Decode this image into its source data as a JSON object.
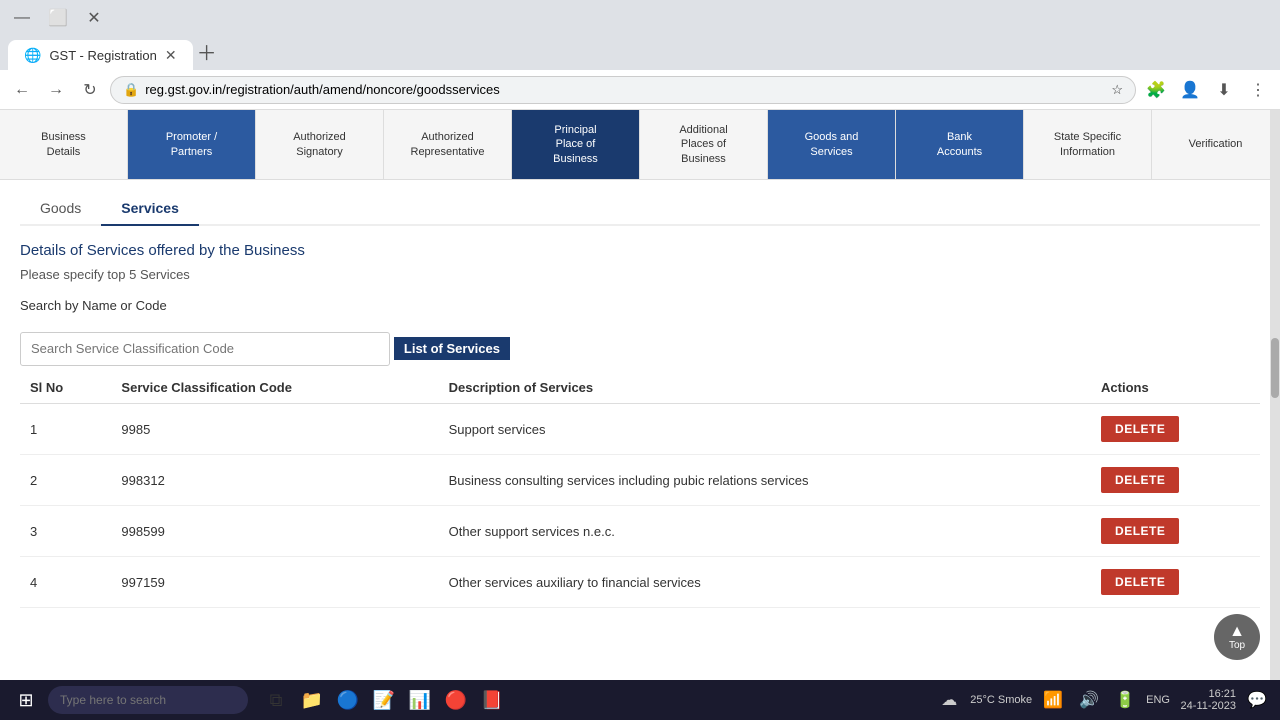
{
  "browser": {
    "tab_title": "GST - Registration",
    "url": "reg.gst.gov.in/registration/auth/amend/noncore/goodsservices",
    "tab_favicon": "🌐"
  },
  "nav_tabs": [
    {
      "id": "business-details",
      "label": "Business\nDetails",
      "active": false
    },
    {
      "id": "promoter-partners",
      "label": "Promoter /\nPartners",
      "active": false,
      "highlighted": true
    },
    {
      "id": "authorized-signatory",
      "label": "Authorized\nSignatory",
      "active": false
    },
    {
      "id": "authorized-representative",
      "label": "Authorized\nRepresentative",
      "active": false
    },
    {
      "id": "principal-place",
      "label": "Principal\nPlace of\nBusiness",
      "active": true
    },
    {
      "id": "additional-places",
      "label": "Additional\nPlaces of\nBusiness",
      "active": false
    },
    {
      "id": "goods-services",
      "label": "Goods and\nServices",
      "active": false,
      "highlighted": true
    },
    {
      "id": "bank-accounts",
      "label": "Bank\nAccounts",
      "active": false,
      "highlighted": true
    },
    {
      "id": "state-specific",
      "label": "State Specific\nInformation",
      "active": false
    },
    {
      "id": "verification",
      "label": "Verification",
      "active": false
    }
  ],
  "section_tabs": [
    {
      "id": "goods",
      "label": "Goods",
      "active": false
    },
    {
      "id": "services",
      "label": "Services",
      "active": true
    }
  ],
  "heading": "Details of Services offered by the Business",
  "subtitle": "Please specify top 5 Services",
  "search_label": "Search by Name or Code",
  "search_placeholder": "Search Service Classification Code",
  "list_heading": "List of Services",
  "table": {
    "columns": [
      "Sl No",
      "Service Classification Code",
      "Description of Services",
      "Actions"
    ],
    "rows": [
      {
        "sl": "1",
        "code": "9985",
        "description": "Support services",
        "action": "DELETE"
      },
      {
        "sl": "2",
        "code": "998312",
        "description": "Business consulting services including pubic relations services",
        "action": "DELETE"
      },
      {
        "sl": "3",
        "code": "998599",
        "description": "Other support services n.e.c.",
        "action": "DELETE"
      },
      {
        "sl": "4",
        "code": "997159",
        "description": "Other services auxiliary to financial services",
        "action": "DELETE"
      }
    ]
  },
  "top_button": {
    "arrow": "▲",
    "label": "Top"
  },
  "taskbar": {
    "search_placeholder": "Type here to search",
    "time": "16:21",
    "date": "24-11-2023",
    "weather": "25°C  Smoke",
    "lang": "ENG"
  },
  "colors": {
    "nav_active": "#1a3a6e",
    "nav_highlighted": "#2c5aa0",
    "delete_btn": "#c0392b",
    "link_color": "#1a3a6e"
  }
}
